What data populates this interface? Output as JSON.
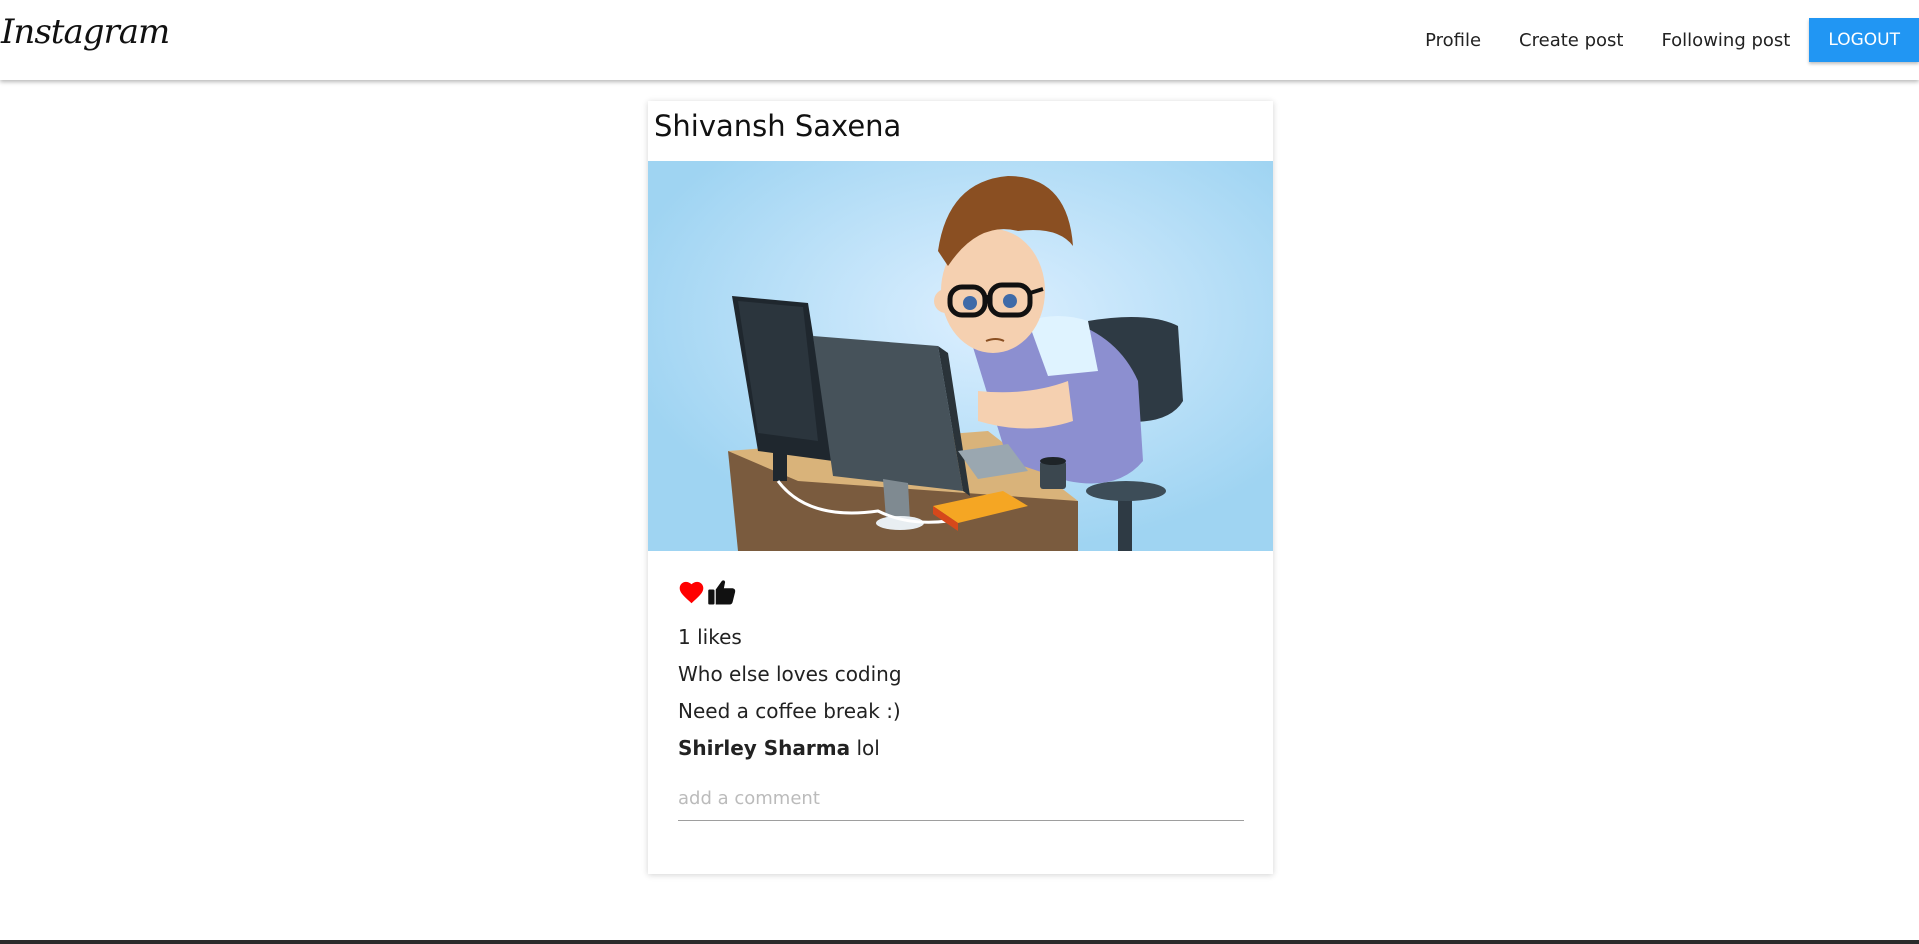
{
  "navbar": {
    "brand": "Instagram",
    "links": [
      "Profile",
      "Create post",
      "Following post"
    ],
    "logout_label": "LOGOUT",
    "accent_color": "#2196f3"
  },
  "post": {
    "author": "Shivansh Saxena",
    "image_icon": "programmer-at-computer-illustration",
    "like_icon": "heart-icon",
    "thumb_icon": "thumbs-up-icon",
    "like_color": "#ff0000",
    "likes_text": "1 likes",
    "title": "Who else loves coding",
    "body": "Need a coffee break :)",
    "comments": [
      {
        "user": "Shirley Sharma",
        "text": "lol"
      }
    ],
    "comment_placeholder": "add a comment"
  }
}
